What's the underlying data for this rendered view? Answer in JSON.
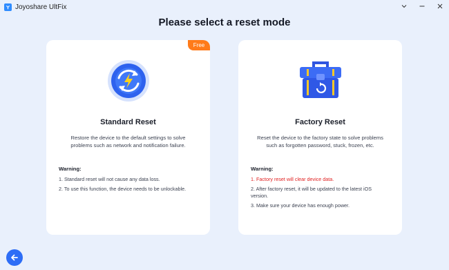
{
  "window": {
    "app_title": "Joyoshare UltFix"
  },
  "page": {
    "title": "Please select a reset mode"
  },
  "cards": {
    "standard": {
      "badge": "Free",
      "title": "Standard Reset",
      "description": "Restore the device to the default settings to solve problems such as network and notification failure.",
      "warning_title": "Warning:",
      "warnings": [
        "1. Standard reset will not cause any data loss.",
        "2. To use this function, the device needs to be unlockable."
      ]
    },
    "factory": {
      "title": "Factory Reset",
      "description": "Reset the device to the factory state to solve problems such as forgotten password, stuck, frozen, etc.",
      "warning_title": "Warning:",
      "warnings": [
        "1. Factory reset will clear device data.",
        "2. After factory reset, it will be updated to the latest iOS version.",
        "3. Make sure your device has enough power."
      ]
    }
  },
  "icons": {
    "app": "app-logo-icon",
    "minimize": "chevron-down-icon",
    "maximize": "maximize-icon",
    "close": "close-icon",
    "standard": "refresh-lightning-icon",
    "factory": "toolbox-icon",
    "back": "arrow-left-icon"
  },
  "colors": {
    "background": "#e9f0fc",
    "accent": "#2d6df6",
    "badge": "#ff7b1a",
    "warning_red": "#e02020"
  }
}
